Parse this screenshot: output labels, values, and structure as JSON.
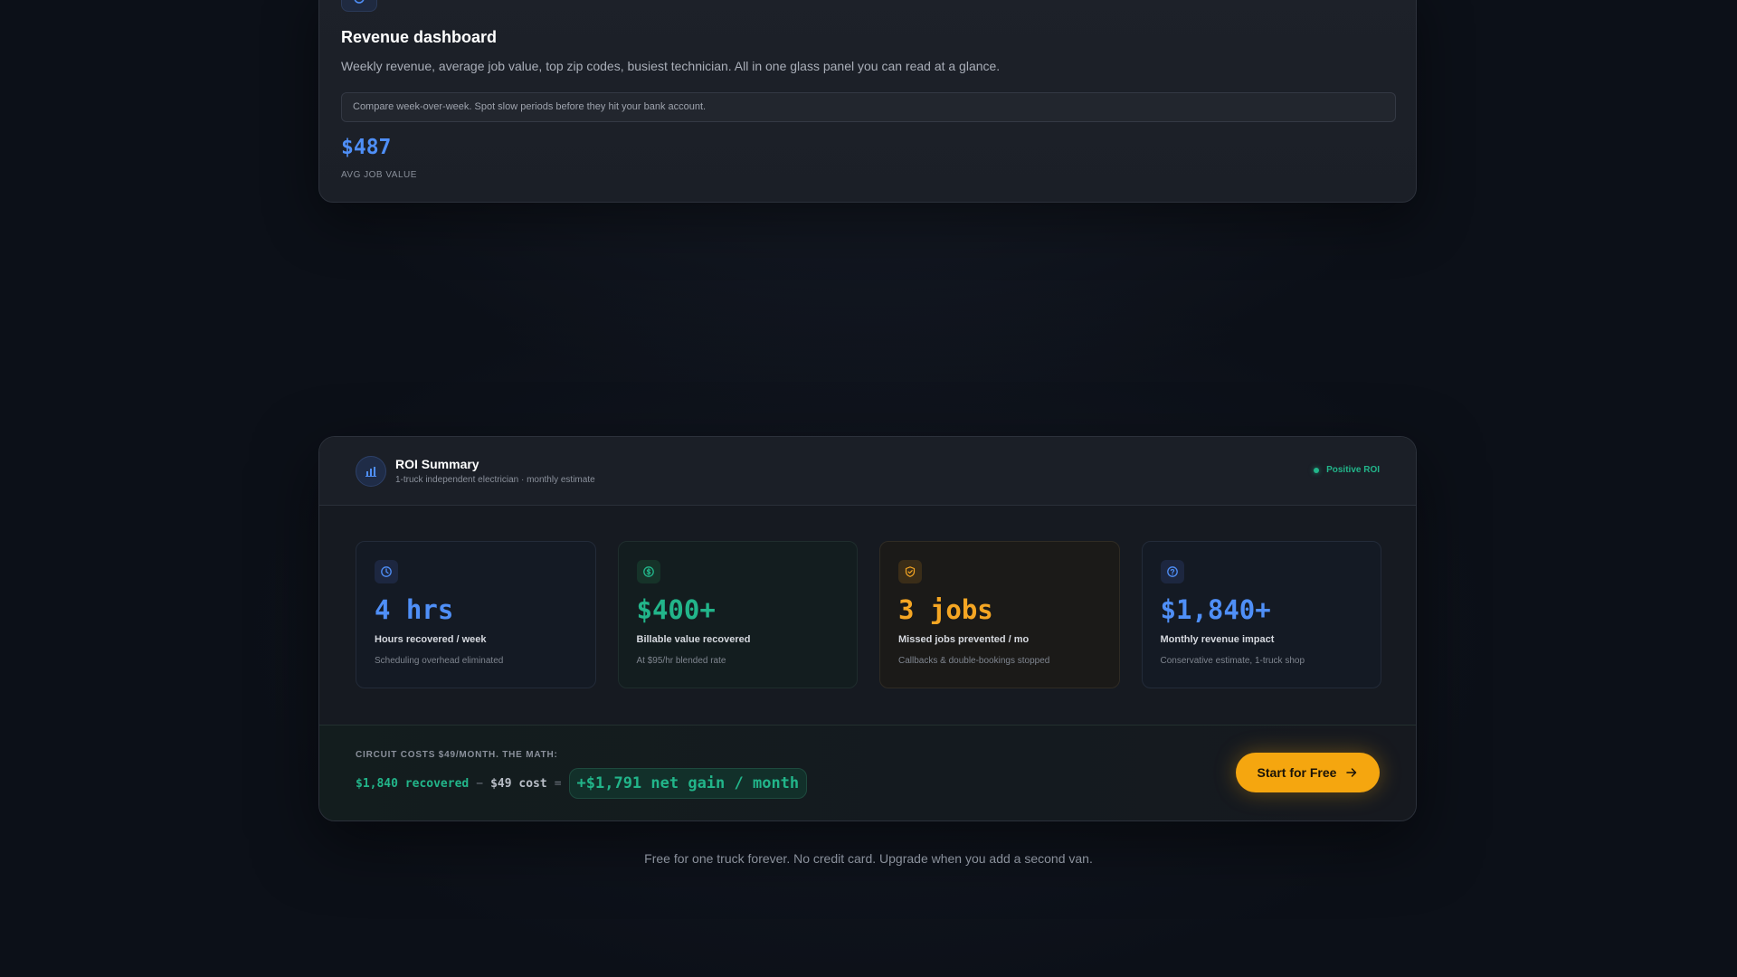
{
  "revenue_card": {
    "title": "Revenue dashboard",
    "description": "Weekly revenue, average job value, top zip codes, busiest technician. All in one glass panel you can read at a glance.",
    "note": "Compare week-over-week. Spot slow periods before they hit your bank account.",
    "metric_value": "$487",
    "metric_label": "AVG JOB VALUE",
    "icon": "chart-icon"
  },
  "roi": {
    "title": "ROI Summary",
    "subtitle": "1-truck independent electrician · monthly estimate",
    "badge": "Positive ROI",
    "header_icon": "bar-chart-icon",
    "stats": [
      {
        "value": "4 hrs",
        "label": "Hours recovered / week",
        "caption": "Scheduling overhead eliminated",
        "icon": "clock-icon",
        "color": "#4f8ff7"
      },
      {
        "value": "$400+",
        "label": "Billable value recovered",
        "caption": "At $95/hr blended rate",
        "icon": "dollar-icon",
        "color": "#22b58a"
      },
      {
        "value": "3 jobs",
        "label": "Missed jobs prevented / mo",
        "caption": "Callbacks & double-bookings stopped",
        "icon": "shield-icon",
        "color": "#f5a623"
      },
      {
        "value": "$1,840+",
        "label": "Monthly revenue impact",
        "caption": "Conservative estimate, 1-truck shop",
        "icon": "help-circle-icon",
        "color": "#4f8ff7"
      }
    ],
    "math": {
      "heading": "CIRCUIT COSTS $49/MONTH. THE MATH:",
      "recovered": "$1,840 recovered",
      "minus": "−",
      "cost": "$49 cost",
      "equals": "=",
      "result": "+$1,791 net gain / month"
    },
    "cta_label": "Start for Free"
  },
  "footer_note": "Free for one truck forever. No credit card. Upgrade when you add a second van.",
  "colors": {
    "background": "#0c1018",
    "accent_blue": "#4f8ff7",
    "accent_green": "#22b58a",
    "accent_amber": "#f5a623",
    "cta": "#f5a60f"
  }
}
